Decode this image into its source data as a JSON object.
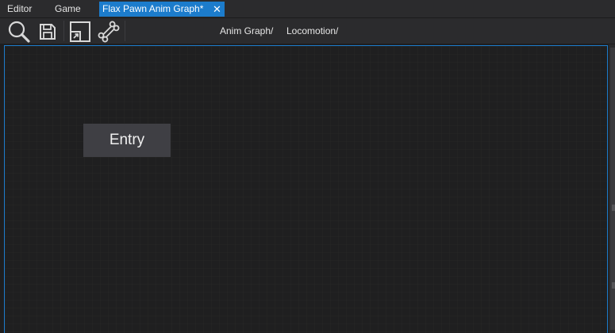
{
  "tabs": [
    {
      "label": "Editor",
      "active": false
    },
    {
      "label": "Game",
      "active": false
    },
    {
      "label": "Flax Pawn Anim Graph*",
      "active": true,
      "close_glyph": "✕"
    }
  ],
  "toolbar": {
    "buttons": [
      {
        "icon": "search-icon"
      },
      {
        "icon": "save-icon"
      },
      {
        "icon": "open-window-icon"
      },
      {
        "icon": "bone-icon"
      }
    ]
  },
  "breadcrumb": [
    "Anim Graph/",
    "Locomotion/"
  ],
  "graph": {
    "nodes": [
      {
        "label": "Entry"
      }
    ]
  },
  "colors": {
    "accent": "#1c7ccc",
    "background": "#1e1e1f",
    "panel": "#2b2b2d",
    "node": "#3f3f44",
    "text": "#e6e6e6"
  }
}
